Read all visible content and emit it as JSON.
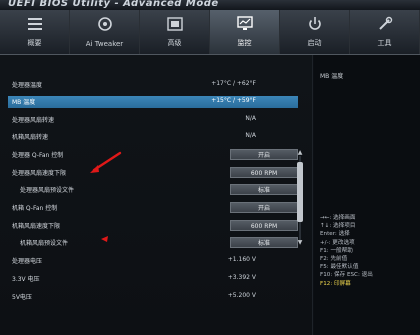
{
  "brand": "UEFI BIOS Utility - Advanced Mode",
  "tabs": [
    {
      "label": "概要",
      "icon": "bars-icon"
    },
    {
      "label": "Ai Tweaker",
      "icon": "fan-icon"
    },
    {
      "label": "高级",
      "icon": "advanced-icon"
    },
    {
      "label": "监控",
      "icon": "monitor-icon",
      "active": true
    },
    {
      "label": "启动",
      "icon": "power-icon"
    },
    {
      "label": "工具",
      "icon": "tool-icon"
    }
  ],
  "rows": [
    {
      "label": "处理器温度",
      "value": "+17°C / +62°F"
    },
    {
      "label": "MB 温度",
      "value": "+15°C / +59°F",
      "selected": true
    },
    {
      "label": "处理器风扇转速",
      "value": "N/A"
    },
    {
      "label": "机箱风扇转速",
      "value": "N/A"
    },
    {
      "label": "处理器 Q-Fan 控制",
      "button": "开启"
    },
    {
      "label": "处理器风扇速度下限",
      "button": "600 RPM"
    },
    {
      "label": "处理器风扇预设文件",
      "button": "标准",
      "sub": true
    },
    {
      "label": "机箱 Q-Fan 控制",
      "button": "开启"
    },
    {
      "label": "机箱风扇速度下限",
      "button": "600 RPM"
    },
    {
      "label": "机箱风扇预设文件",
      "button": "标准",
      "sub": true
    },
    {
      "label": "处理器电压",
      "value": "+1.160 V"
    },
    {
      "label": "3.3V 电压",
      "value": "+3.392 V"
    },
    {
      "label": "5V电压",
      "value": "+5.200 V"
    }
  ],
  "description": {
    "title": "MB 温度"
  },
  "hints": [
    "→←: 选择画面",
    "↑↓: 选择项目",
    "Enter: 选择",
    "+/-: 更改选项",
    "F1: 一般帮助",
    "F2: 先前值",
    "F5: 最佳默认值",
    "F10: 保存 ESC: 退出",
    "F12: 印屏幕"
  ],
  "colors": {
    "selected_row": "#3c86b8",
    "hint_highlight": "#f2d94e",
    "annotation_arrow": "#e01818"
  }
}
